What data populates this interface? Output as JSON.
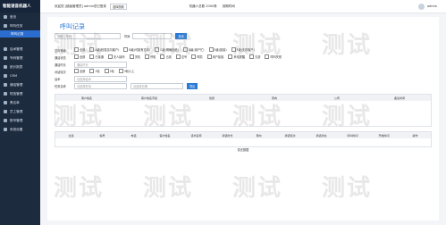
{
  "app": {
    "title": "智能语音机器人"
  },
  "sidebar": {
    "items": [
      {
        "label": "首页",
        "active": false,
        "sub": false
      },
      {
        "label": "呼叫任务",
        "active": false,
        "sub": false
      },
      {
        "label": "呼叫记录",
        "active": true,
        "sub": true
      },
      {
        "label": "",
        "active": false,
        "sub": true
      },
      {
        "label": "话术管理",
        "active": false,
        "sub": false
      },
      {
        "label": "号码管理",
        "active": false,
        "sub": false
      },
      {
        "label": "统计报表",
        "active": false,
        "sub": false
      },
      {
        "label": "CRM",
        "active": false,
        "sub": false
      },
      {
        "label": "通话管理",
        "active": false,
        "sub": false
      },
      {
        "label": "短信管理",
        "active": false,
        "sub": false
      },
      {
        "label": "黑名单",
        "active": false,
        "sub": false
      },
      {
        "label": "员工管理",
        "active": false,
        "sub": false
      },
      {
        "label": "账号管理",
        "active": false,
        "sub": false
      },
      {
        "label": "系统设置",
        "active": false,
        "sub": false
      }
    ]
  },
  "topbar": {
    "greeting": "欢迎您 [超级管理员] admin您已登录",
    "switch_label": "选择视频",
    "robot_count": "机器人总数 2000条",
    "expiry": "到期时间",
    "user": "admin"
  },
  "panel": {
    "title": "呼叫记录",
    "row1_input_placeholder": "请输入号码",
    "row1_label2": "时间",
    "search_button": "查询",
    "intent_label": "意向等级",
    "intents": [
      "全部",
      "A级(较强意向客户)",
      "B级(可能有意向)",
      "C级(明确拒绝)",
      "D级(用户忙)",
      "E级(拒接)",
      "F级(无效客户)"
    ],
    "status_label": "通话状态",
    "statuses": [
      "全部",
      "已接通",
      "无人接听",
      "关机",
      "停机",
      "占线",
      "空号",
      "呼损",
      "用户拒接",
      "来电提醒",
      "欠费",
      "呼叫失败"
    ],
    "duration_label": "通话时长",
    "duration_placeholder": "通话时长",
    "rounds_label": "对话轮次",
    "rounds_options": [
      "全部",
      "1轮",
      "2轮",
      "3轮以上"
    ],
    "speech_label": "话术",
    "speech_placeholder": "请选择话术",
    "task_label": "任务名称",
    "task_placeholder": "请选择任务",
    "date_placeholder": "请选择日期",
    "export_button": "导出",
    "columns_header": [
      "客户姓名",
      "客户姓名字段",
      "性别",
      "意向",
      "公司",
      "备注时间"
    ],
    "table_headers": [
      "全选",
      "编号",
      "电话",
      "客户姓名",
      "话术名称",
      "通话时长",
      "意向",
      "通话轮次",
      "通话状态",
      "呼叫时间",
      "开始时间",
      "操作"
    ],
    "empty_text": "暂无数据"
  },
  "watermark": {
    "text": "测试"
  }
}
